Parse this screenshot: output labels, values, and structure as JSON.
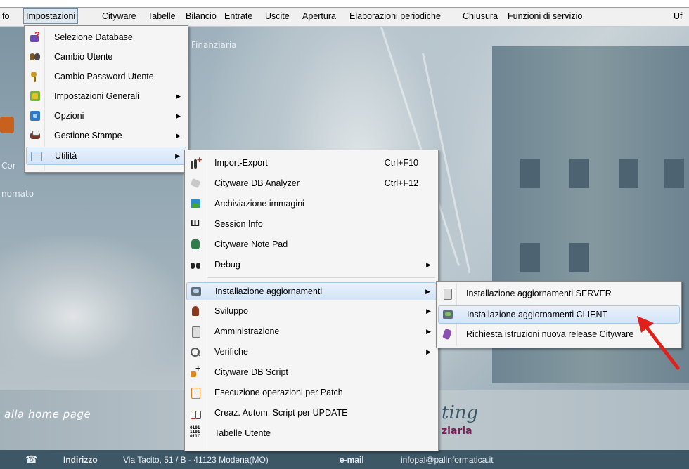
{
  "menubar": {
    "items": [
      "fo",
      "Impostazioni",
      "Cityware",
      "Tabelle",
      "Bilancio",
      "Entrate",
      "Uscite",
      "Apertura",
      "Elaborazioni periodiche",
      "Chiusura",
      "Funzioni di servizio",
      "Uf"
    ]
  },
  "impostazioni_menu": {
    "items": [
      {
        "label": "Selezione Database",
        "icon": "database-question-icon"
      },
      {
        "label": "Cambio Utente",
        "icon": "users-icon"
      },
      {
        "label": "Cambio Password Utente",
        "icon": "keys-icon"
      },
      {
        "label": "Impostazioni Generali",
        "icon": "settings-grid-icon"
      },
      {
        "label": "Opzioni",
        "icon": "options-icon"
      },
      {
        "label": "Gestione Stampe",
        "icon": "printer-icon"
      },
      {
        "label": "Utilità",
        "icon": "utility-icon"
      }
    ]
  },
  "utilita_menu": {
    "items": [
      {
        "label": "Import-Export",
        "shortcut": "Ctrl+F10",
        "icon": "import-export-icon"
      },
      {
        "label": "Cityware DB Analyzer",
        "shortcut": "Ctrl+F12",
        "icon": "db-analyzer-icon"
      },
      {
        "label": "Archiviazione immagini",
        "shortcut": "",
        "icon": "image-archive-icon"
      },
      {
        "label": "Session Info",
        "shortcut": "",
        "icon": "session-info-icon"
      },
      {
        "label": "Cityware Note Pad",
        "shortcut": "",
        "icon": "notepad-icon"
      },
      {
        "label": "Debug",
        "shortcut": "",
        "icon": "binoculars-icon"
      },
      {
        "label": "Installazione aggiornamenti",
        "shortcut": "",
        "icon": "install-updates-icon"
      },
      {
        "label": "Sviluppo",
        "shortcut": "",
        "icon": "development-icon"
      },
      {
        "label": "Amministrazione",
        "shortcut": "",
        "icon": "admin-icon"
      },
      {
        "label": "Verifiche",
        "shortcut": "",
        "icon": "magnifier-icon"
      },
      {
        "label": "Cityware DB Script",
        "shortcut": "",
        "icon": "db-script-icon"
      },
      {
        "label": "Esecuzione operazioni per Patch",
        "shortcut": "",
        "icon": "patch-icon"
      },
      {
        "label": "Creaz. Autom. Script per UPDATE",
        "shortcut": "",
        "icon": "script-update-icon"
      },
      {
        "label": "Tabelle Utente",
        "shortcut": "",
        "icon": "binary-table-icon"
      }
    ]
  },
  "installazione_menu": {
    "items": [
      {
        "label": "Installazione aggiornamenti SERVER",
        "icon": "server-icon"
      },
      {
        "label": "Installazione aggiornamenti CLIENT",
        "icon": "client-icon"
      },
      {
        "label": "Richiesta istruzioni nuova release Cityware",
        "icon": "release-request-icon"
      }
    ]
  },
  "background": {
    "subtitle": "Finanziaria",
    "left_label_1": "Cor",
    "left_label_2": "nomato",
    "home_link": "alla home page",
    "brand_big": "ting",
    "brand_small": "ziaria"
  },
  "footer": {
    "indirizzo_label": "Indirizzo",
    "indirizzo_value": "Via Tacito, 51 / B - 41123 Modena(MO)",
    "email_label": "e-mail",
    "email_value": "infopal@palinformatica.it"
  },
  "colors": {
    "highlight": "#d3e4f7",
    "footer_bg": "#3d5767",
    "arrow": "#e0201b"
  }
}
